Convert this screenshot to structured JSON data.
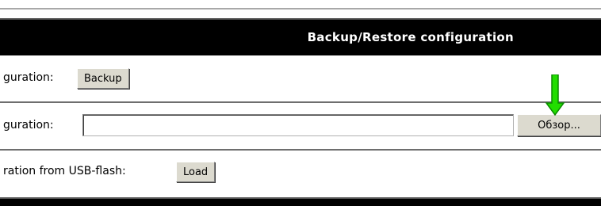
{
  "header": {
    "title": "Backup/Restore configuration"
  },
  "rows": [
    {
      "label": "guration:",
      "button": "Backup"
    },
    {
      "label": "guration:",
      "input_value": "",
      "browse_button": "Обзор..."
    },
    {
      "label": "ration from USB-flash:",
      "button": "Load"
    }
  ],
  "annotation": {
    "arrow_color": "#22dd00",
    "icon": "down-arrow-icon"
  }
}
